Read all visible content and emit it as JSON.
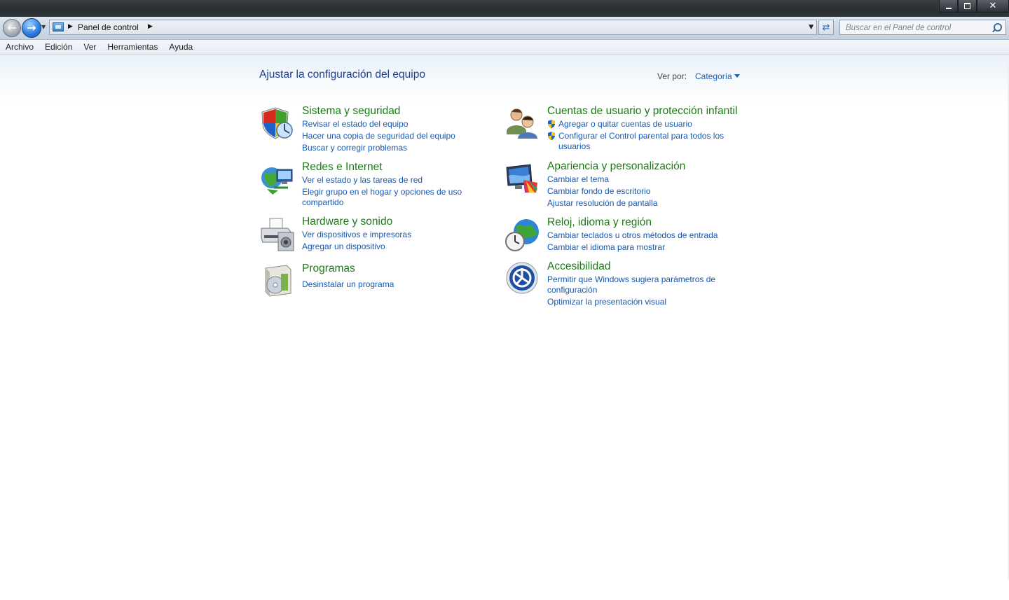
{
  "window": {
    "controls": {
      "minimize": "–",
      "maximize": "□",
      "close": "✕"
    }
  },
  "navigation": {
    "back_icon": "back-arrow-icon",
    "forward_icon": "forward-arrow-icon",
    "breadcrumb": [
      "Panel de control"
    ],
    "search_placeholder": "Buscar en el Panel de control"
  },
  "menu": [
    "Archivo",
    "Edición",
    "Ver",
    "Herramientas",
    "Ayuda"
  ],
  "main": {
    "title": "Ajustar la configuración del equipo",
    "view_by_label": "Ver por:",
    "view_by_value": "Categoría"
  },
  "categories": [
    {
      "title": "Sistema y seguridad",
      "icon": "shield-icon",
      "links": [
        "Revisar el estado del equipo",
        "Hacer una copia de seguridad del equipo",
        "Buscar y corregir problemas"
      ]
    },
    {
      "title": "Redes e Internet",
      "icon": "network-globe-icon",
      "links": [
        "Ver el estado y las tareas de red",
        "Elegir grupo en el hogar y opciones de uso compartido"
      ]
    },
    {
      "title": "Hardware y sonido",
      "icon": "printer-icon",
      "links": [
        "Ver dispositivos e impresoras",
        "Agregar un dispositivo"
      ]
    },
    {
      "title": "Programas",
      "icon": "programs-icon",
      "links": [
        "Desinstalar un programa"
      ]
    },
    {
      "title": "Cuentas de usuario y protección infantil",
      "icon": "users-icon",
      "links": [
        "Agregar o quitar cuentas de usuario",
        "Configurar el Control parental para todos los usuarios"
      ]
    },
    {
      "title": "Apariencia y personalización",
      "icon": "monitor-palette-icon",
      "links": [
        "Cambiar el tema",
        "Cambiar fondo de escritorio",
        "Ajustar resolución de pantalla"
      ]
    },
    {
      "title": "Reloj, idioma y región",
      "icon": "clock-globe-icon",
      "links": [
        "Cambiar teclados u otros métodos de entrada",
        "Cambiar el idioma para mostrar"
      ]
    },
    {
      "title": "Accesibilidad",
      "icon": "accessibility-icon",
      "links": [
        "Permitir que Windows sugiera parámetros de configuración",
        "Optimizar la presentación visual"
      ]
    }
  ]
}
